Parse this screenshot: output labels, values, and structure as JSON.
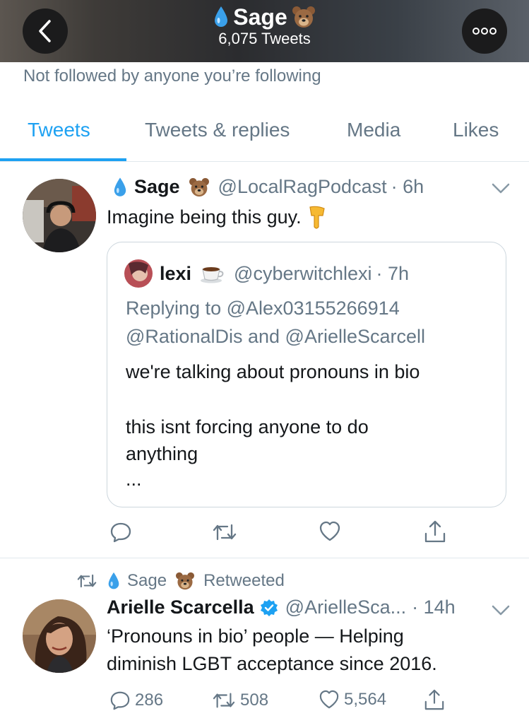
{
  "header": {
    "name": "Sage",
    "tweet_count": "6,075 Tweets",
    "back_icon": "chevron-left-icon",
    "more_icon": "more-dots-icon"
  },
  "profile_note": "Not followed by anyone you’re following",
  "tabs": [
    {
      "label": "Tweets",
      "active": true
    },
    {
      "label": "Tweets & replies",
      "active": false
    },
    {
      "label": "Media",
      "active": false
    },
    {
      "label": "Likes",
      "active": false
    }
  ],
  "tweet1": {
    "name": "Sage",
    "handle": "@LocalRagPodcast",
    "time": "· 6h",
    "text": "Imagine being this guy.",
    "quote": {
      "name": "lexi",
      "handle": "@cyberwitchlexi",
      "time": "· 7h",
      "replying_prefix": "Replying to ",
      "replying_to_1": "@Alex03155266914",
      "replying_to_2": "@RationalDis",
      "replying_and": " and ",
      "replying_to_3": "@ArielleScarcell",
      "line1": "we're talking about pronouns in bio",
      "line2": "this isnt forcing anyone to do",
      "line3": "anything",
      "ellipsis": "..."
    }
  },
  "tweet2": {
    "retweeted_by": "Sage",
    "retweeted_label": "Retweeted",
    "name": "Arielle Scarcella",
    "handle": "@ArielleSca...",
    "time": "· 14h",
    "text_line1": "‘Pronouns in bio’ people — Helping",
    "text_line2": "diminish LGBT acceptance since 2016.",
    "replies": "286",
    "retweets": "508",
    "likes": "5,564"
  },
  "colors": {
    "accent": "#1da1f2",
    "secondary_text": "#657786",
    "verified": "#1da1f2"
  }
}
